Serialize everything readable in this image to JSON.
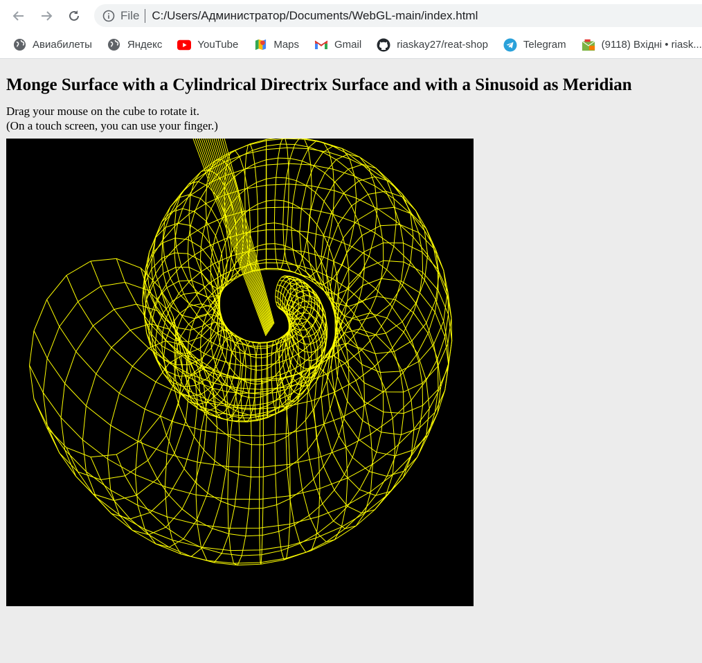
{
  "browser": {
    "scheme": "File",
    "url": "C:/Users/Администратор/Documents/WebGL-main/index.html",
    "bookmarks": [
      {
        "label": "Авиабилеты",
        "icon": "globe-icon"
      },
      {
        "label": "Яндекс",
        "icon": "globe-icon"
      },
      {
        "label": "YouTube",
        "icon": "youtube-icon"
      },
      {
        "label": "Maps",
        "icon": "maps-icon"
      },
      {
        "label": "Gmail",
        "icon": "gmail-icon"
      },
      {
        "label": "riaskay27/reat-shop",
        "icon": "github-icon"
      },
      {
        "label": "Telegram",
        "icon": "telegram-icon"
      },
      {
        "label": "(9118) Вхідні • riask...",
        "icon": "mail-folder-icon"
      }
    ]
  },
  "page": {
    "title": "Monge Surface with a Cylindrical Directrix Surface and with a Sinusoid as Meridian",
    "instruction_line1": "Drag your mouse on the cube to rotate it.",
    "instruction_line2": "(On a touch screen, you can use your finger.)"
  },
  "canvas": {
    "background": "#000000",
    "wire_color": "#ffff00"
  }
}
